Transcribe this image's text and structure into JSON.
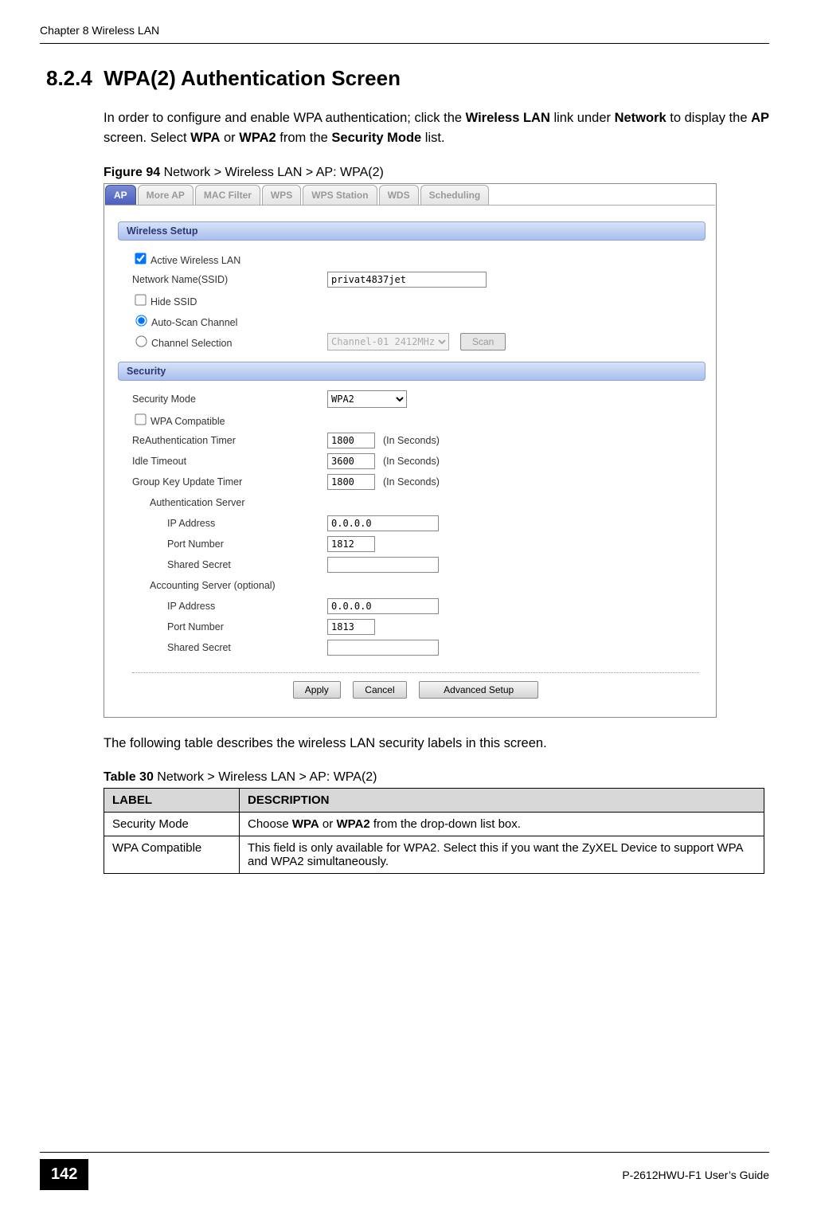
{
  "header": {
    "chapter": "Chapter 8 Wireless LAN"
  },
  "section": {
    "number": "8.2.4",
    "title": "WPA(2) Authentication Screen"
  },
  "para1": {
    "t1": "In order to configure and enable WPA authentication; click the ",
    "b1": "Wireless LAN",
    "t2": " link under ",
    "b2": "Network",
    "t3": " to display the ",
    "b3": "AP",
    "t4": " screen. Select ",
    "b4": "WPA",
    "t5": " or ",
    "b5": "WPA2",
    "t6": " from the ",
    "b6": "Security Mode",
    "t7": " list."
  },
  "figure": {
    "label_bold": "Figure 94",
    "label_rest": "   Network > Wireless LAN > AP: WPA(2)"
  },
  "tabs": {
    "t0": "AP",
    "t1": "More AP",
    "t2": "MAC Filter",
    "t3": "WPS",
    "t4": "WPS Station",
    "t5": "WDS",
    "t6": "Scheduling"
  },
  "ui": {
    "group_wireless": "Wireless Setup",
    "active_wlan": "Active Wireless LAN",
    "ssid_label": "Network Name(SSID)",
    "ssid_value": "privat4837jet",
    "hide_ssid": "Hide SSID",
    "auto_scan": "Auto-Scan Channel",
    "channel_sel_label": "Channel Selection",
    "channel_sel_value": "Channel-01 2412MHz",
    "scan_btn": "Scan",
    "group_security": "Security",
    "sec_mode_label": "Security Mode",
    "sec_mode_value": "WPA2",
    "wpa_compat": "WPA Compatible",
    "reauth_label": "ReAuthentication Timer",
    "reauth_value": "1800",
    "idle_label": "Idle Timeout",
    "idle_value": "3600",
    "gkey_label": "Group Key Update Timer",
    "gkey_value": "1800",
    "seconds_hint": "(In Seconds)",
    "auth_server": "Authentication Server",
    "ip_label": "IP Address",
    "auth_ip": "0.0.0.0",
    "port_label": "Port Number",
    "auth_port": "1812",
    "secret_label": "Shared Secret",
    "acct_server": "Accounting Server (optional)",
    "acct_ip": "0.0.0.0",
    "acct_port": "1813",
    "apply": "Apply",
    "cancel": "Cancel",
    "advanced": "Advanced Setup"
  },
  "para2": "The following table describes the wireless LAN security labels in this screen.",
  "table": {
    "label_bold": "Table 30",
    "label_rest": "   Network > Wireless LAN > AP: WPA(2)",
    "h_label": "LABEL",
    "h_desc": "DESCRIPTION",
    "r1_label": "Security Mode",
    "r1_desc_a": "Choose ",
    "r1_desc_b1": "WPA",
    "r1_desc_mid": " or ",
    "r1_desc_b2": "WPA2",
    "r1_desc_c": " from the drop-down list box.",
    "r2_label": "WPA Compatible",
    "r2_desc": "This field is only available for WPA2. Select this if you want the ZyXEL Device to support WPA and WPA2 simultaneously."
  },
  "footer": {
    "page": "142",
    "guide": "P-2612HWU-F1 User’s Guide"
  }
}
